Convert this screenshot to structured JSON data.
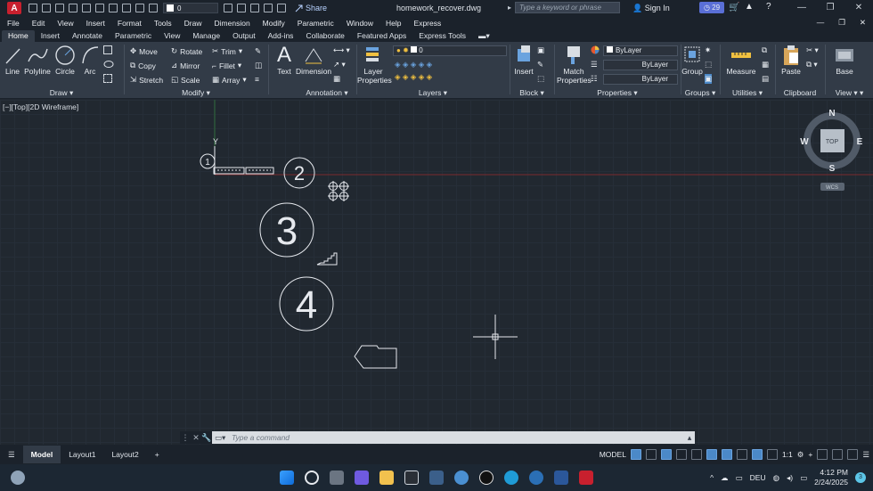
{
  "titlebar": {
    "app_logo": "A",
    "layer_value": "0",
    "share_label": "Share",
    "doc_title": "homework_recover.dwg",
    "search_placeholder": "Type a keyword or phrase",
    "sign_in": "Sign In",
    "notif_count": "29",
    "window_controls": [
      "—",
      "❐",
      "✕"
    ]
  },
  "menubar": {
    "items": [
      "File",
      "Edit",
      "View",
      "Insert",
      "Format",
      "Tools",
      "Draw",
      "Dimension",
      "Modify",
      "Parametric",
      "Window",
      "Help",
      "Express"
    ],
    "mdi_controls": [
      "—",
      "❐",
      "✕"
    ]
  },
  "ribbon_tabs": [
    "Home",
    "Insert",
    "Annotate",
    "Parametric",
    "View",
    "Manage",
    "Output",
    "Add-ins",
    "Collaborate",
    "Featured Apps",
    "Express Tools"
  ],
  "ribbon": {
    "draw": {
      "title": "Draw",
      "tools": [
        "Line",
        "Polyline",
        "Circle",
        "Arc"
      ]
    },
    "modify": {
      "title": "Modify",
      "tools": [
        "Move",
        "Rotate",
        "Trim",
        "Copy",
        "Mirror",
        "Fillet",
        "Stretch",
        "Scale",
        "Array"
      ]
    },
    "annotation": {
      "title": "Annotation",
      "tools": [
        "Text",
        "Dimension"
      ]
    },
    "layers": {
      "title": "Layers",
      "tool": "Layer Properties",
      "layer_value": "0"
    },
    "block": {
      "title": "Block",
      "tool": "Insert"
    },
    "properties": {
      "title": "Properties",
      "tool": "Match Properties",
      "bylayer": [
        "ByLayer",
        "ByLayer",
        "ByLayer"
      ]
    },
    "groups": {
      "title": "Groups",
      "tool": "Group"
    },
    "utilities": {
      "title": "Utilities",
      "tool": "Measure"
    },
    "clipboard": {
      "title": "Clipboard",
      "tool": "Paste"
    },
    "view": {
      "title": "View",
      "tool": "Base"
    }
  },
  "viewport": {
    "label": "[−][Top][2D Wireframe]",
    "ucs_y": "Y",
    "viewcube": {
      "top": "TOP",
      "north": "N",
      "south": "S",
      "east": "E",
      "west": "W",
      "wcs": "WCS"
    },
    "numbers": [
      "1",
      "2",
      "3",
      "4"
    ]
  },
  "cmdline": {
    "placeholder": "Type a command"
  },
  "statusbar": {
    "layout_tabs": [
      "Model",
      "Layout1",
      "Layout2"
    ],
    "add_tab": "+",
    "model_label": "MODEL",
    "scale": "1:1"
  },
  "taskbar": {
    "lang": "DEU",
    "time": "4:12 PM",
    "date": "2/24/2025",
    "notif": "3"
  },
  "colors": {
    "ribbon_bg": "#323b47",
    "canvas_bg": "#212830",
    "accent": "#4b89c8",
    "brand_red": "#c8202e"
  }
}
